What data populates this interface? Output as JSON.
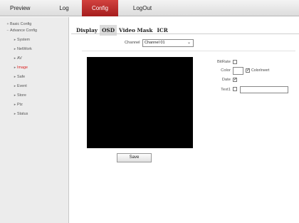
{
  "topnav": {
    "preview": "Preview",
    "log": "Log",
    "config": "Config",
    "logout": "LogOut",
    "active_color": "#c0312f"
  },
  "sidebar": {
    "basic_config": "Basic Config",
    "advance_config": "Advance Config",
    "items": [
      {
        "label": "System"
      },
      {
        "label": "NetWork"
      },
      {
        "label": "AV"
      },
      {
        "label": "Image"
      },
      {
        "label": "Safe"
      },
      {
        "label": "Event"
      },
      {
        "label": "Store"
      },
      {
        "label": "Ptz"
      },
      {
        "label": "Status"
      }
    ],
    "active_item": "Image"
  },
  "tabs": [
    {
      "label": "Display"
    },
    {
      "label": "OSD"
    },
    {
      "label": "Video Mask"
    },
    {
      "label": "ICR"
    }
  ],
  "channel": {
    "label": "Channel",
    "selected": "Channel 01"
  },
  "osd": {
    "bitrate_label": "BitRate",
    "bitrate_checked": false,
    "color_label": "Color",
    "colorinvert_label": "ColorInvert",
    "colorinvert_checked": true,
    "date_label": "Date",
    "date_checked": true,
    "text1_label": "Text1",
    "text1_checked": false,
    "text1_value": ""
  },
  "save_label": "Save"
}
